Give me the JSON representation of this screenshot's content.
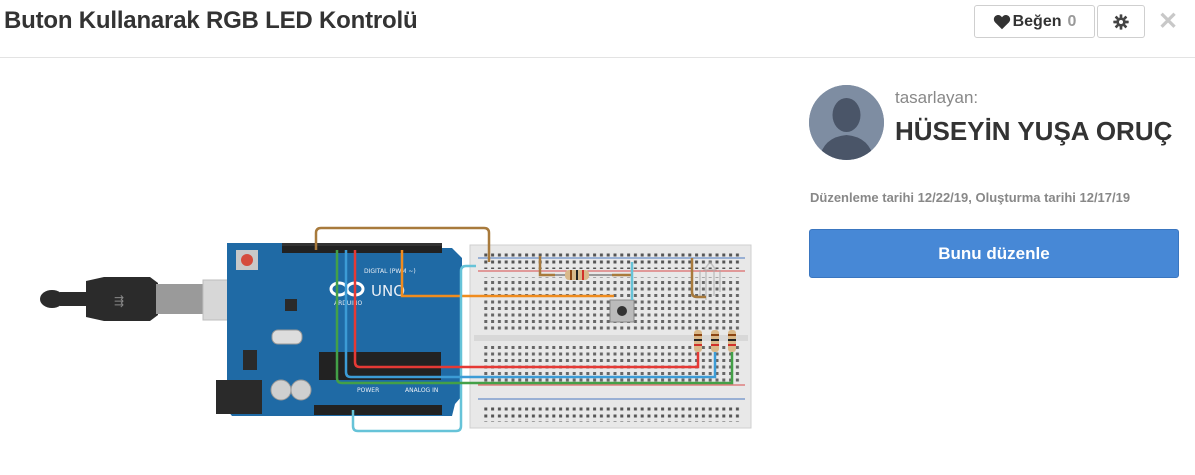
{
  "header": {
    "title": "Buton Kullanarak RGB LED Kontrolü",
    "like_label": "Beğen",
    "like_count": "0"
  },
  "designer": {
    "label": "tasarlayan:",
    "name": "HÜSEYİN YUŞA ORUÇ"
  },
  "dates": "Düzenleme tarihi 12/22/19, Oluşturma tarihi 12/17/19",
  "edit_button": "Bunu düzenle",
  "board": {
    "digital_label": "DIGITAL (PWM ~)",
    "power_label": "POWER",
    "analog_label": "ANALOG IN",
    "uno_label": "UNO",
    "brand_label": "ARDUINO"
  },
  "colors": {
    "primary": "#4788d6",
    "arduino_blue": "#1f6aa5",
    "wire_red": "#e53935",
    "wire_blue": "#3c9cd6",
    "wire_green": "#43a047",
    "wire_orange": "#f08c1e",
    "wire_brown": "#a87a3c",
    "wire_cyan": "#66c3d8"
  }
}
